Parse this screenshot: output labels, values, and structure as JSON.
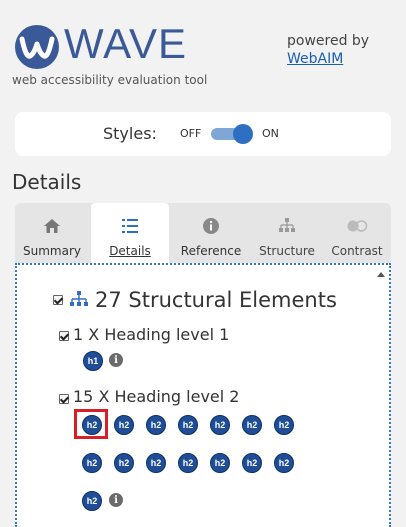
{
  "header": {
    "logo_text": "WAVE",
    "tagline": "web accessibility evaluation tool",
    "powered_by": "powered by",
    "webaim_link": "WebAIM"
  },
  "styles_toggle": {
    "label": "Styles:",
    "off": "OFF",
    "on": "ON",
    "state": "on"
  },
  "section_title": "Details",
  "tabs": [
    {
      "label": "Summary",
      "icon": "home-icon",
      "active": false
    },
    {
      "label": "Details",
      "icon": "list-icon",
      "active": true
    },
    {
      "label": "Reference",
      "icon": "info-icon",
      "active": false
    },
    {
      "label": "Structure",
      "icon": "sitemap-icon",
      "active": false
    },
    {
      "label": "Contrast",
      "icon": "contrast-icon",
      "active": false
    }
  ],
  "details": {
    "summary": "27 Structural Elements",
    "groups": [
      {
        "title": "1 X Heading level 1",
        "badge": "h1",
        "count": 1
      },
      {
        "title": "15 X Heading level 2",
        "badge": "h2",
        "count": 15
      }
    ]
  },
  "colors": {
    "accent": "#2f6fc3",
    "badge": "#1f4e96",
    "selection": "#d81f26",
    "link": "#1a5fb4"
  }
}
